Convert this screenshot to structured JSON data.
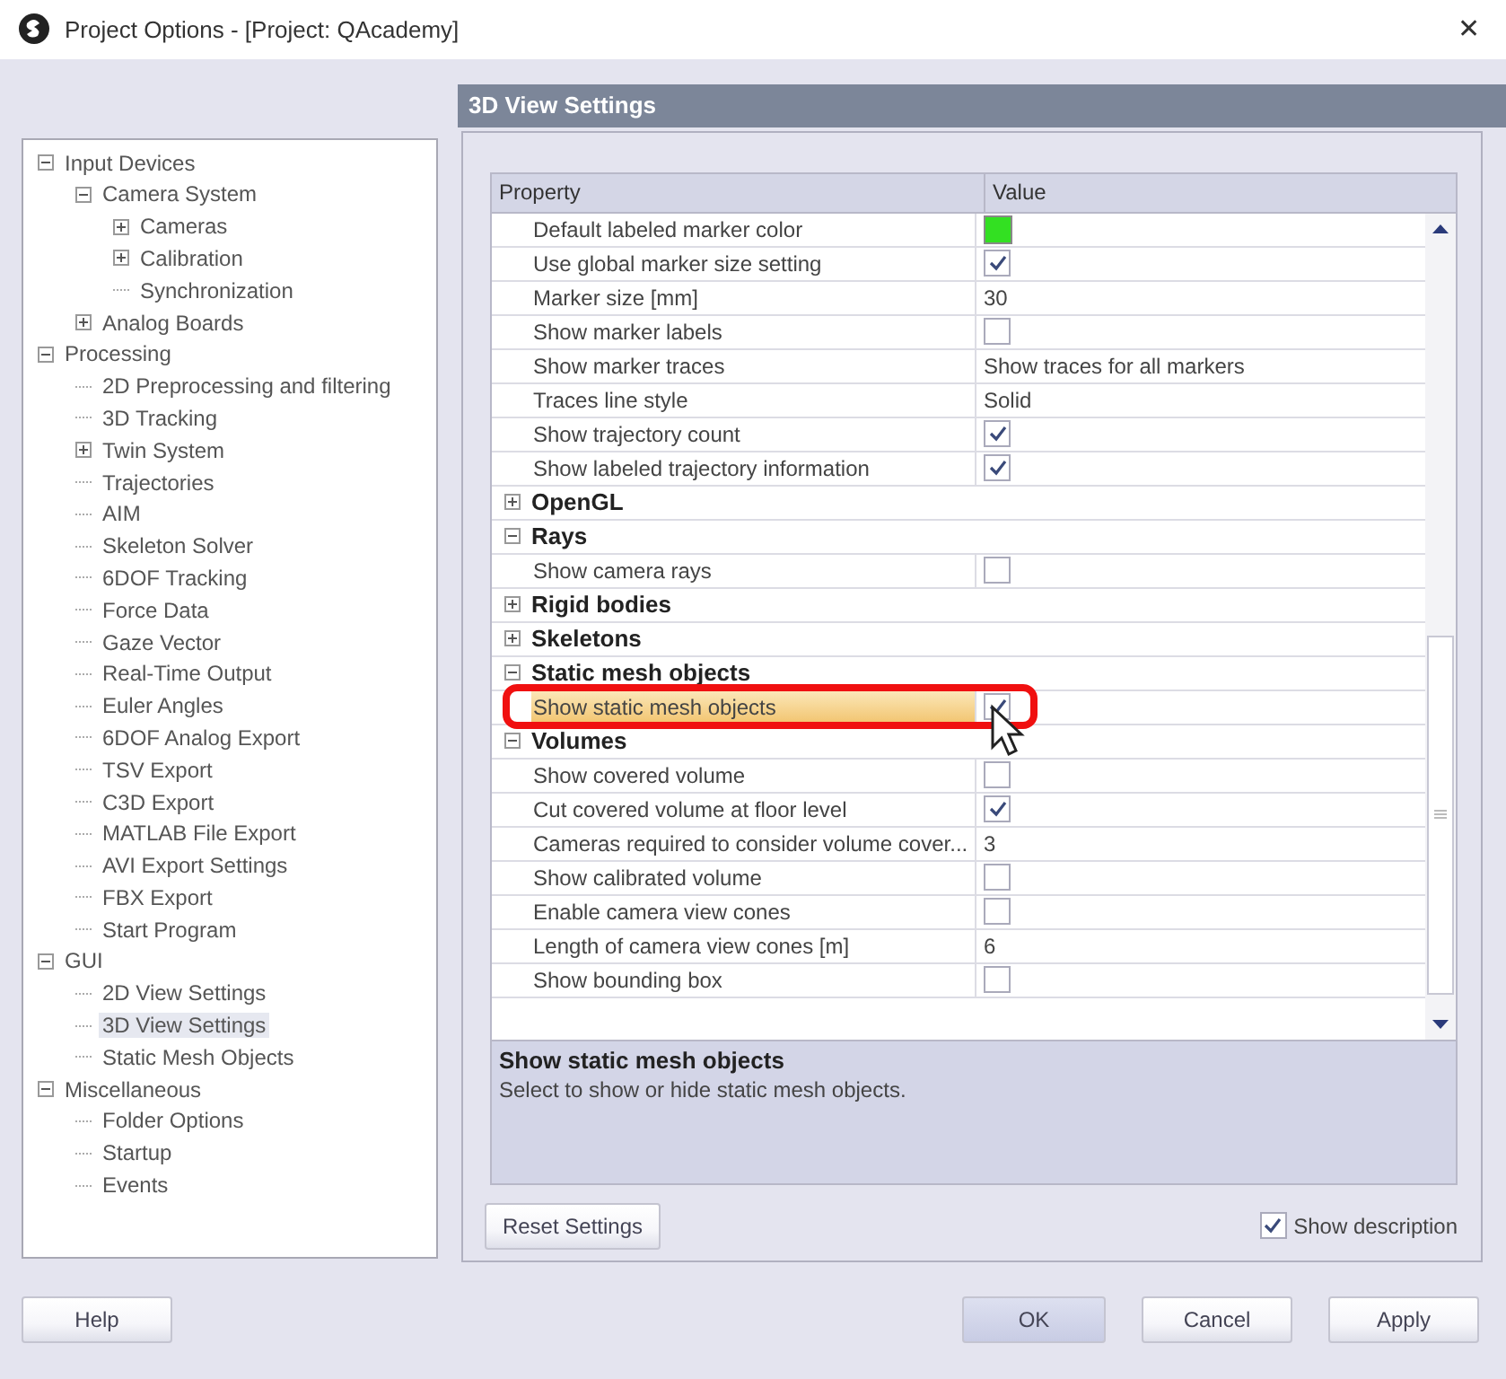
{
  "window": {
    "title": "Project Options - [Project: QAcademy]",
    "close": "✕"
  },
  "tree": [
    {
      "label": "Input Devices",
      "expanded": true,
      "selected": false,
      "children": [
        {
          "label": "Camera System",
          "expanded": true,
          "selected": false,
          "children": [
            {
              "label": "Cameras",
              "expanded": false,
              "selected": false
            },
            {
              "label": "Calibration",
              "expanded": false,
              "selected": false
            },
            {
              "label": "Synchronization",
              "selected": false
            }
          ]
        },
        {
          "label": "Analog Boards",
          "expanded": false,
          "selected": false
        }
      ]
    },
    {
      "label": "Processing",
      "expanded": true,
      "selected": false,
      "children": [
        {
          "label": "2D Preprocessing and filtering",
          "selected": false
        },
        {
          "label": "3D Tracking",
          "selected": false
        },
        {
          "label": "Twin System",
          "expanded": false,
          "selected": false
        },
        {
          "label": "Trajectories",
          "selected": false
        },
        {
          "label": "AIM",
          "selected": false
        },
        {
          "label": "Skeleton Solver",
          "selected": false
        },
        {
          "label": "6DOF Tracking",
          "selected": false
        },
        {
          "label": "Force Data",
          "selected": false
        },
        {
          "label": "Gaze Vector",
          "selected": false
        },
        {
          "label": "Real-Time Output",
          "selected": false
        },
        {
          "label": "Euler Angles",
          "selected": false
        },
        {
          "label": "6DOF Analog Export",
          "selected": false
        },
        {
          "label": "TSV Export",
          "selected": false
        },
        {
          "label": "C3D Export",
          "selected": false
        },
        {
          "label": "MATLAB File Export",
          "selected": false
        },
        {
          "label": "AVI Export Settings",
          "selected": false
        },
        {
          "label": "FBX Export",
          "selected": false
        },
        {
          "label": "Start Program",
          "selected": false
        }
      ]
    },
    {
      "label": "GUI",
      "expanded": true,
      "selected": false,
      "children": [
        {
          "label": "2D View Settings",
          "selected": false
        },
        {
          "label": "3D View Settings",
          "selected": true
        },
        {
          "label": "Static Mesh Objects",
          "selected": false
        }
      ]
    },
    {
      "label": "Miscellaneous",
      "expanded": true,
      "selected": false,
      "children": [
        {
          "label": "Folder Options",
          "selected": false
        },
        {
          "label": "Startup",
          "selected": false
        },
        {
          "label": "Events",
          "selected": false
        }
      ]
    }
  ],
  "page_title": "3D View Settings",
  "grid": {
    "columns": [
      "Property",
      "Value"
    ],
    "rows": [
      {
        "kind": "color",
        "name": "Default labeled marker color",
        "color": "#33e022",
        "selected": false
      },
      {
        "kind": "check",
        "name": "Use global marker size setting",
        "checked": true,
        "selected": false
      },
      {
        "kind": "text",
        "name": "Marker size [mm]",
        "value": "30",
        "selected": false
      },
      {
        "kind": "check",
        "name": "Show marker labels",
        "checked": false,
        "selected": false
      },
      {
        "kind": "text",
        "name": "Show marker traces",
        "value": "Show traces for all markers",
        "selected": false
      },
      {
        "kind": "text",
        "name": "Traces line style",
        "value": "Solid",
        "selected": false
      },
      {
        "kind": "check",
        "name": "Show trajectory count",
        "checked": true,
        "selected": false
      },
      {
        "kind": "check",
        "name": "Show labeled trajectory information",
        "checked": true,
        "selected": false
      },
      {
        "kind": "category",
        "name": "OpenGL",
        "expanded": false
      },
      {
        "kind": "category",
        "name": "Rays",
        "expanded": true
      },
      {
        "kind": "check",
        "name": "Show camera rays",
        "checked": false,
        "selected": false
      },
      {
        "kind": "category",
        "name": "Rigid bodies",
        "expanded": false
      },
      {
        "kind": "category",
        "name": "Skeletons",
        "expanded": false
      },
      {
        "kind": "category",
        "name": "Static mesh objects",
        "expanded": true
      },
      {
        "kind": "check",
        "name": "Show static mesh objects",
        "checked": true,
        "selected": true
      },
      {
        "kind": "category",
        "name": "Volumes",
        "expanded": true
      },
      {
        "kind": "check",
        "name": "Show covered volume",
        "checked": false,
        "selected": false
      },
      {
        "kind": "check",
        "name": "Cut covered volume at floor level",
        "checked": true,
        "selected": false
      },
      {
        "kind": "text",
        "name": "Cameras required to consider volume cover...",
        "value": "3",
        "selected": false
      },
      {
        "kind": "check",
        "name": "Show calibrated volume",
        "checked": false,
        "selected": false
      },
      {
        "kind": "check",
        "name": "Enable camera view cones",
        "checked": false,
        "selected": false
      },
      {
        "kind": "text",
        "name": "Length of camera view cones [m]",
        "value": "6",
        "selected": false
      },
      {
        "kind": "check",
        "name": "Show bounding box",
        "checked": false,
        "selected": false
      }
    ]
  },
  "description": {
    "title": "Show static mesh objects",
    "text": "Select to show or hide static mesh objects."
  },
  "reset_button": "Reset Settings",
  "show_description": {
    "label": "Show description",
    "checked": true
  },
  "buttons": {
    "help": "Help",
    "ok": "OK",
    "cancel": "Cancel",
    "apply": "Apply"
  }
}
